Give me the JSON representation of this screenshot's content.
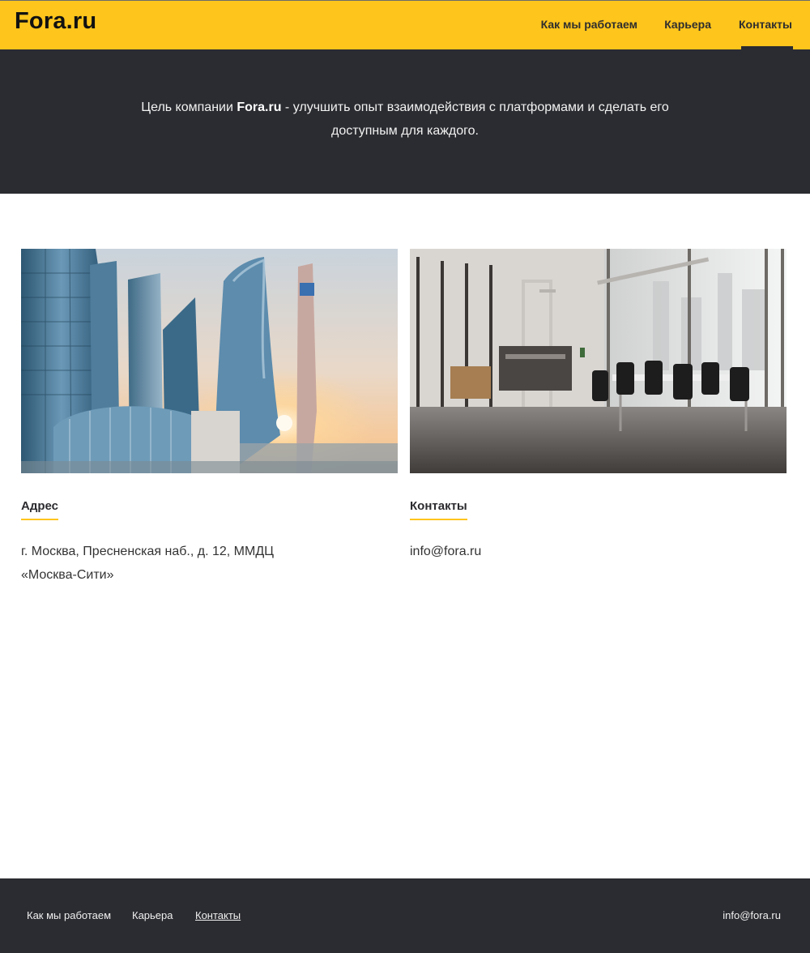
{
  "header": {
    "logo": "Fora.ru",
    "nav": [
      {
        "label": "Как мы работаем"
      },
      {
        "label": "Карьера"
      },
      {
        "label": "Контакты",
        "active": true
      }
    ]
  },
  "hero": {
    "text_before": "Цель компании ",
    "brand": "Fora.ru",
    "text_after": " - улучшить опыт взаимодействия с платформами и сделать его доступным для каждого."
  },
  "address": {
    "title": "Адрес",
    "line1": "г. Москва, Пресненская наб., д. 12, ММДЦ",
    "line2": "«Москва-Сити»"
  },
  "contacts": {
    "title": "Контакты",
    "email": "info@fora.ru"
  },
  "footer": {
    "links": [
      "Как мы работаем",
      "Карьера",
      "Контакты"
    ],
    "email": "info@fora.ru"
  },
  "colors": {
    "accent": "#fec51c",
    "dark": "#2b2c31"
  }
}
